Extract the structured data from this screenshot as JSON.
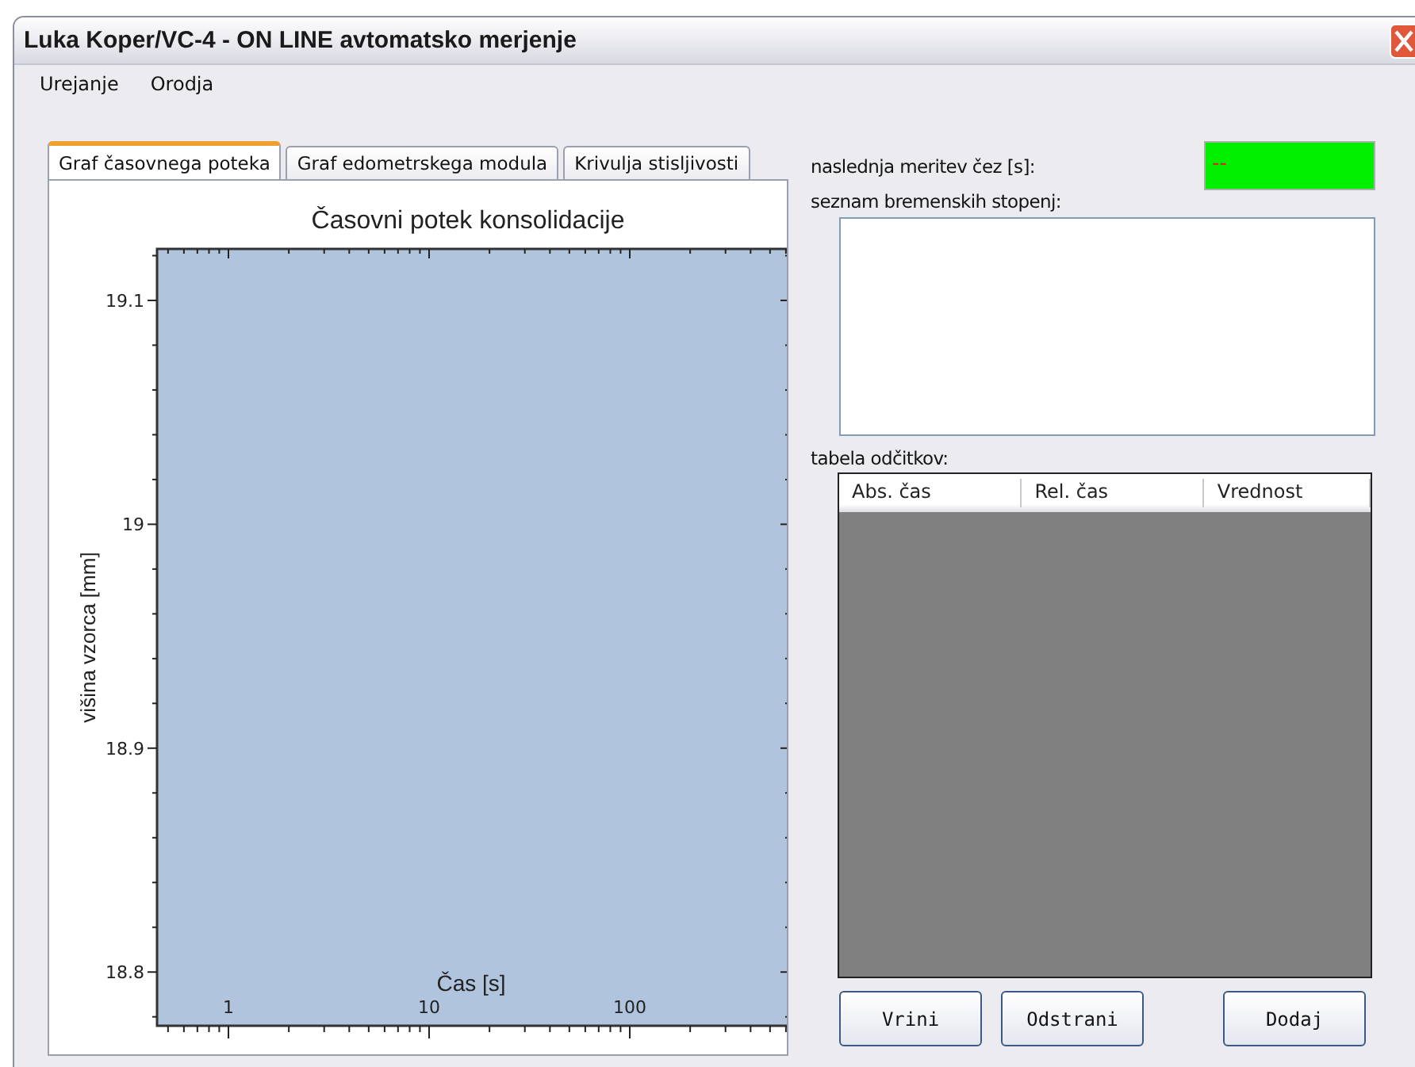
{
  "window": {
    "title": "Luka Koper/VC-4 - ON LINE avtomatsko merjenje"
  },
  "menu": [
    "Urejanje",
    "Orodja"
  ],
  "tabs": [
    {
      "label": "Graf časovnega poteka",
      "selected": true
    },
    {
      "label": "Graf edometrskega modula",
      "selected": false
    },
    {
      "label": "Krivulja stisljivosti",
      "selected": false
    }
  ],
  "chart": {
    "chart_data": {
      "type": "line",
      "title": "Časovni potek konsolidacije",
      "xlabel": "Čas [s]",
      "ylabel": "višina vzorca [mm]",
      "categories": [
        "1",
        "10",
        "100"
      ],
      "ylim": [
        18.776,
        19.123
      ],
      "yticks": [
        18.8,
        18.9,
        19,
        19.1
      ]
    }
  },
  "next_measurement": {
    "label": "naslednja meritev čez [s]:",
    "value": "--"
  },
  "load_steps": {
    "label": "seznam bremenskih stopenj:"
  },
  "readings_table": {
    "label": "tabela odčitkov:",
    "columns": [
      "Abs. čas",
      "Rel. čas",
      "Vrednost"
    ]
  },
  "buttons": [
    "Vrini",
    "Odstrani",
    "Dodaj"
  ]
}
